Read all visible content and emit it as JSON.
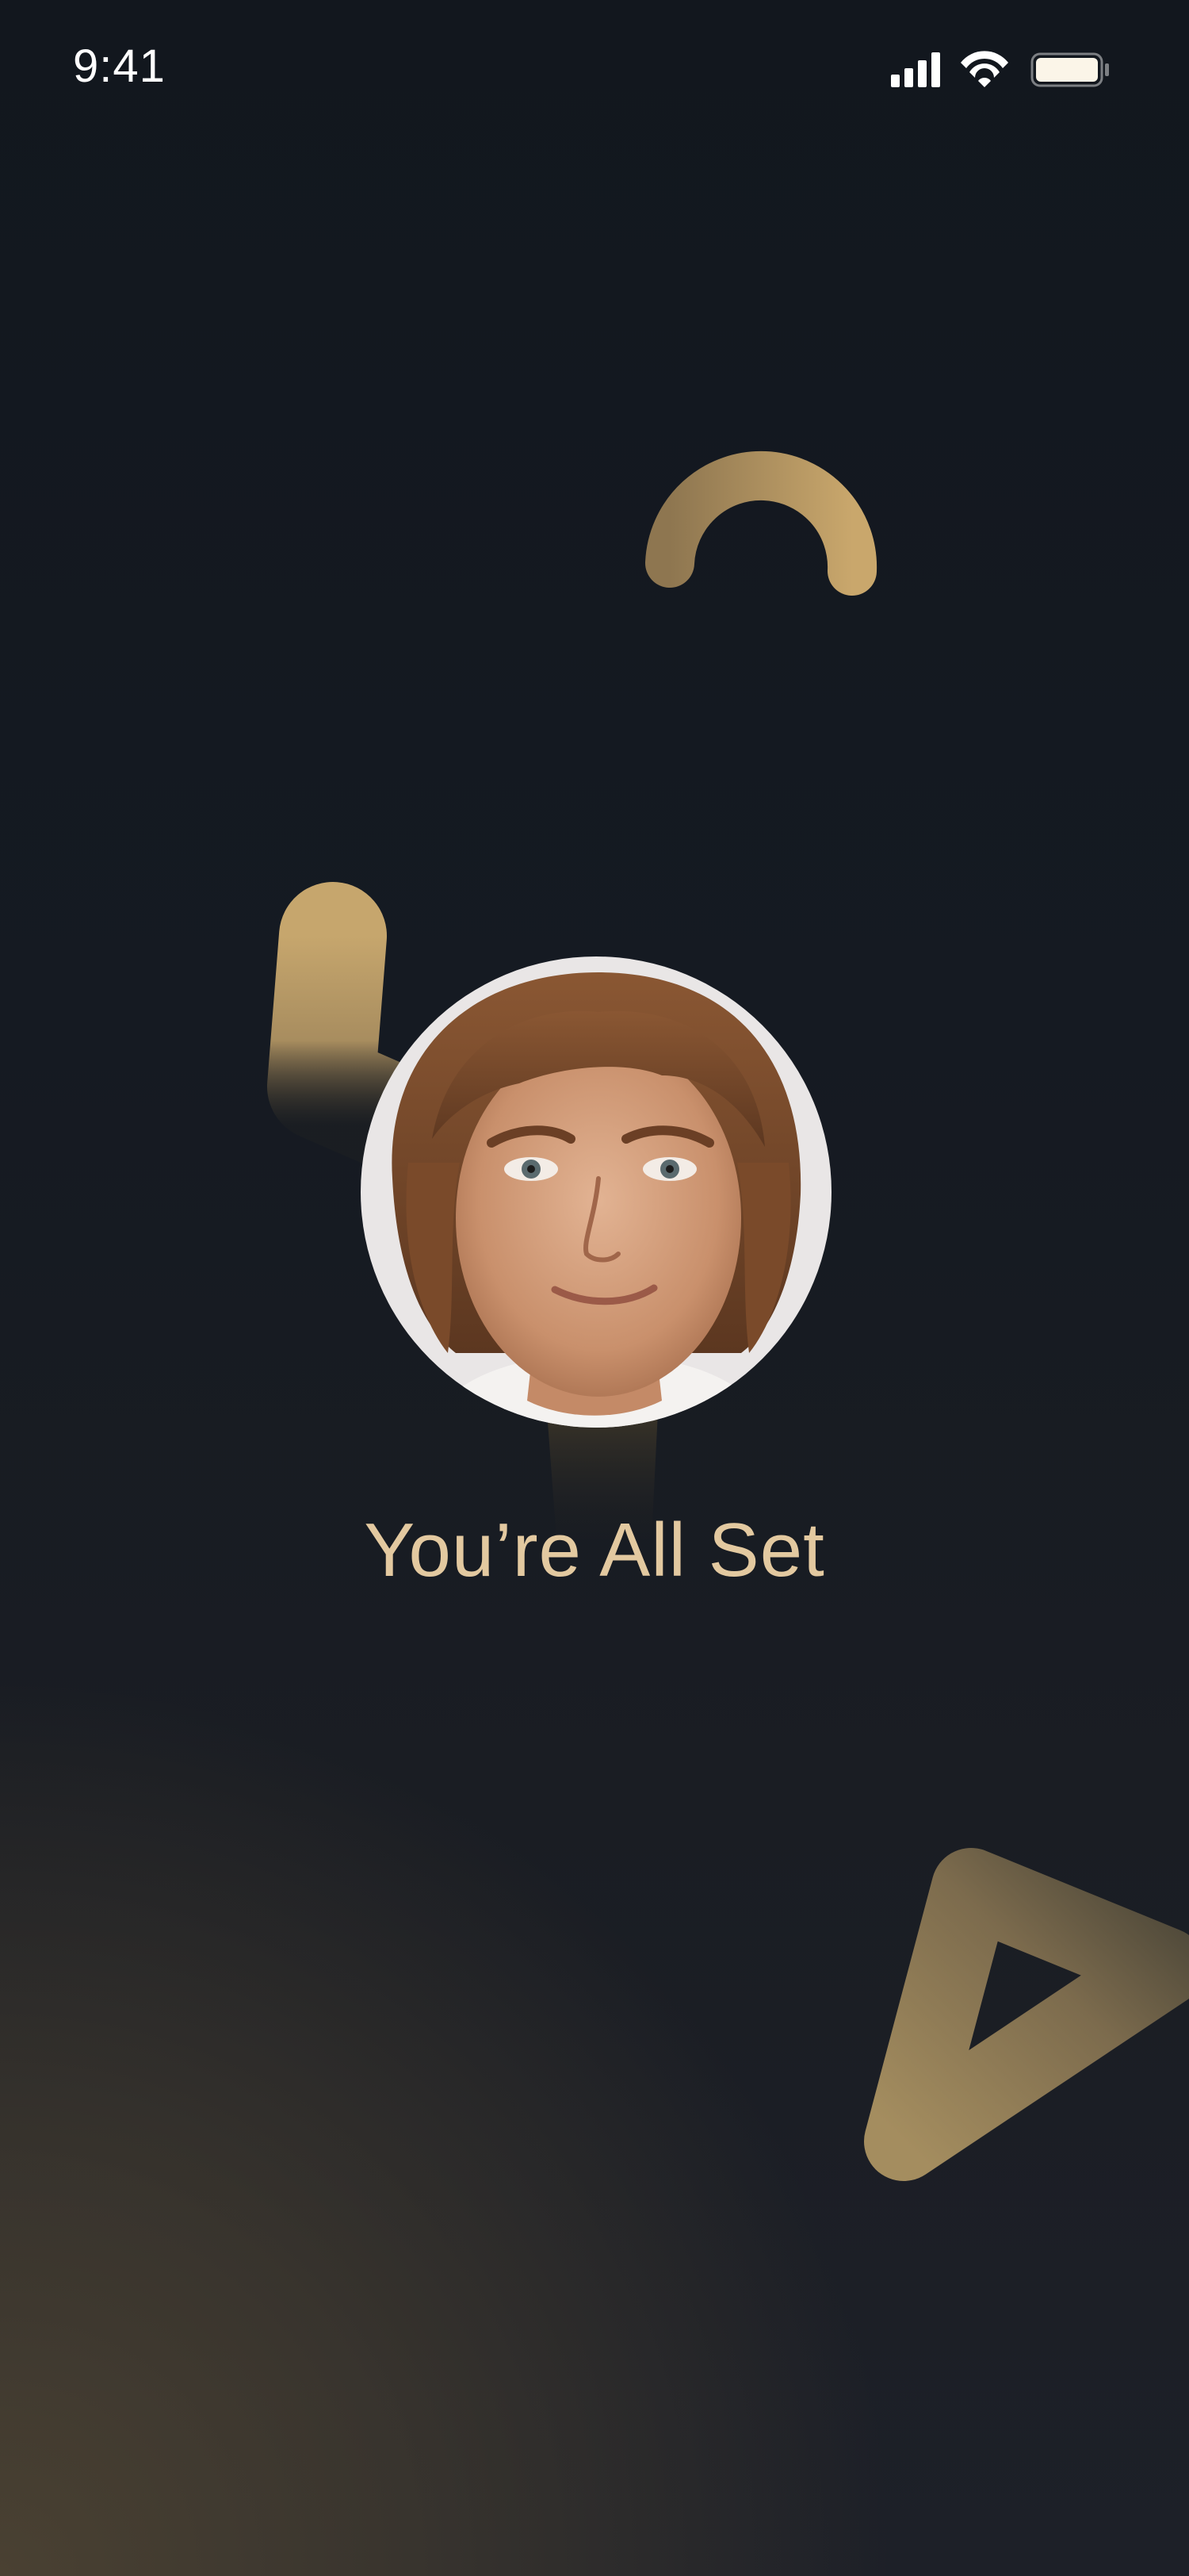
{
  "status_bar": {
    "time": "9:41",
    "icons": [
      "cellular-signal-icon",
      "wifi-icon",
      "battery-icon"
    ]
  },
  "main": {
    "avatar_icon": "profile-photo",
    "headline": "You’re All Set"
  },
  "decorations": [
    "arc-shape",
    "l-shape",
    "triangle-shape"
  ],
  "colors": {
    "background_top": "#12171e",
    "background_bottom_left": "#4a4132",
    "accent_gold": "#c9a76c",
    "headline_text": "#e3c9a0"
  }
}
